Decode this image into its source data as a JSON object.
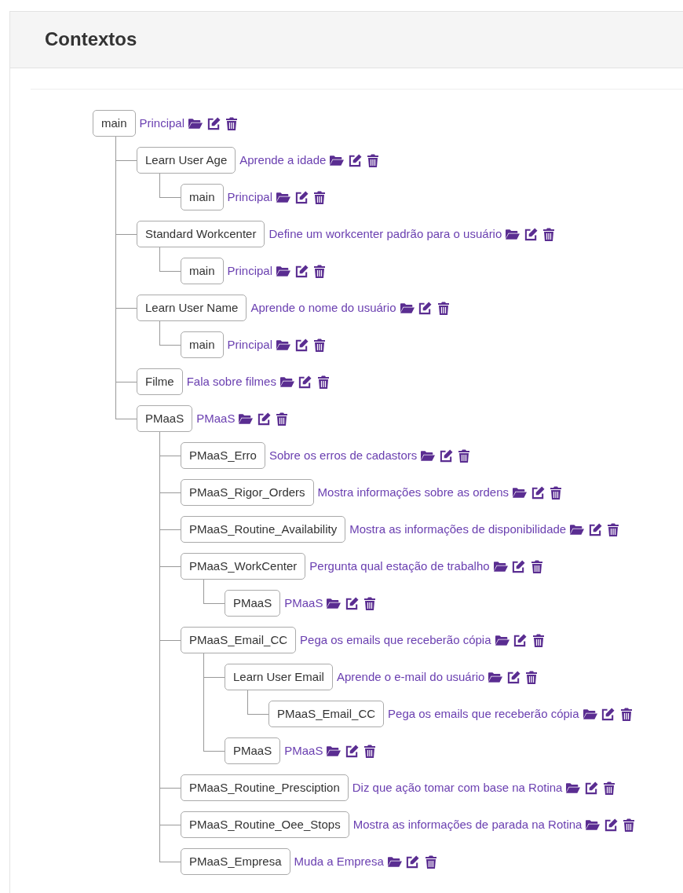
{
  "title": "Contextos",
  "tree": [
    {
      "name": "main",
      "description": "Principal",
      "children": [
        {
          "name": "Learn User Age",
          "description": "Aprende a idade",
          "children": [
            {
              "name": "main",
              "description": "Principal"
            }
          ]
        },
        {
          "name": "Standard Workcenter",
          "description": "Define um workcenter padrão para o usuário",
          "children": [
            {
              "name": "main",
              "description": "Principal"
            }
          ]
        },
        {
          "name": "Learn User Name",
          "description": "Aprende o nome do usuário",
          "children": [
            {
              "name": "main",
              "description": "Principal"
            }
          ]
        },
        {
          "name": "Filme",
          "description": "Fala sobre filmes"
        },
        {
          "name": "PMaaS",
          "description": "PMaaS",
          "children": [
            {
              "name": "PMaaS_Erro",
              "description": "Sobre os erros de cadastors"
            },
            {
              "name": "PMaaS_Rigor_Orders",
              "description": "Mostra informações sobre as ordens"
            },
            {
              "name": "PMaaS_Routine_Availability",
              "description": "Mostra as informações de disponibilidade"
            },
            {
              "name": "PMaaS_WorkCenter",
              "description": "Pergunta qual estação de trabalho",
              "children": [
                {
                  "name": "PMaaS",
                  "description": "PMaaS"
                }
              ]
            },
            {
              "name": "PMaaS_Email_CC",
              "description": "Pega os emails que receberão cópia",
              "children": [
                {
                  "name": "Learn User Email",
                  "description": "Aprende o e-mail do usuário",
                  "children": [
                    {
                      "name": "PMaaS_Email_CC",
                      "description": "Pega os emails que receberão cópia"
                    }
                  ]
                },
                {
                  "name": "PMaaS",
                  "description": "PMaaS"
                }
              ]
            },
            {
              "name": "PMaaS_Routine_Presciption",
              "description": "Diz que ação tomar com base na Rotina"
            },
            {
              "name": "PMaaS_Routine_Oee_Stops",
              "description": "Mostra as informações de parada na Rotina"
            },
            {
              "name": "PMaaS_Empresa",
              "description": "Muda a Empresa"
            }
          ]
        }
      ]
    }
  ]
}
